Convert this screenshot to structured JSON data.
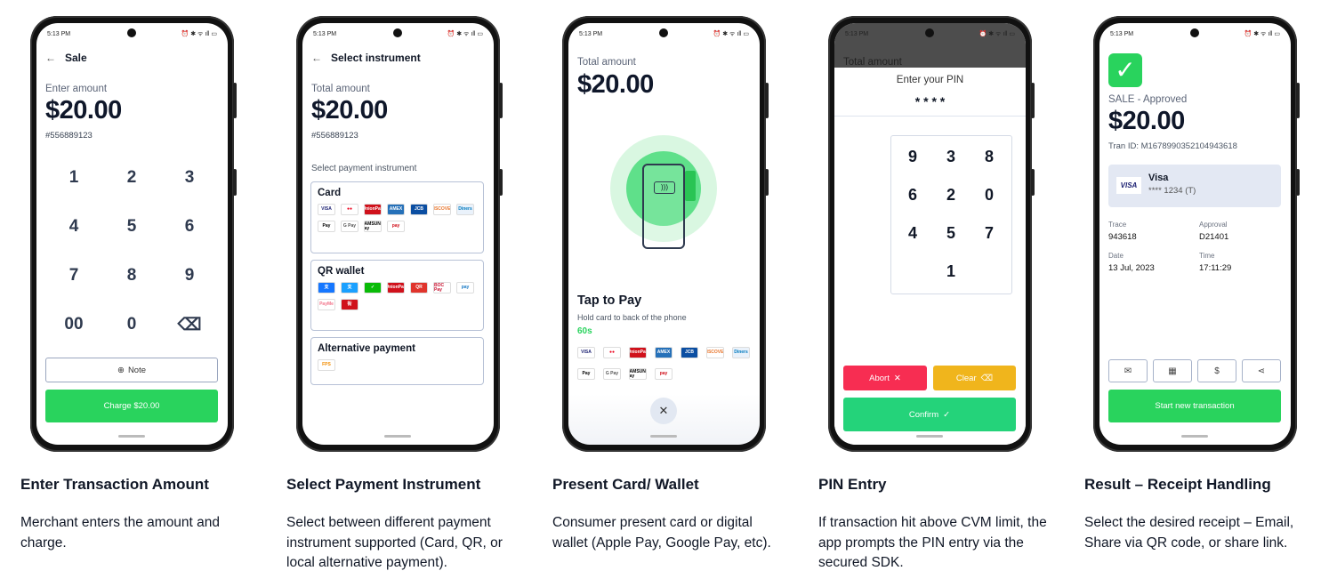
{
  "status": {
    "time": "5:13 PM",
    "icons": [
      "alarm-icon",
      "bluetooth-icon",
      "wifi-icon",
      "signal-icon",
      "battery-icon"
    ]
  },
  "colors": {
    "green": "#29d35d",
    "red": "#f72d52",
    "amber": "#f0b51c",
    "confirm": "#24d37a"
  },
  "screen1": {
    "title": "Sale",
    "label": "Enter amount",
    "amount": "$20.00",
    "ref": "#556889123",
    "keys": [
      "1",
      "2",
      "3",
      "4",
      "5",
      "6",
      "7",
      "8",
      "9",
      "00",
      "0",
      "⌫"
    ],
    "note": "Note",
    "charge": "Charge $20.00"
  },
  "screen2": {
    "title": "Select instrument",
    "label": "Total amount",
    "amount": "$20.00",
    "ref": "#556889123",
    "section": "Select payment instrument",
    "groups": [
      {
        "title": "Card",
        "logos": [
          [
            "VISA",
            "#fff",
            "#1a1f71"
          ],
          [
            "●●",
            "#fff",
            "#eb001b"
          ],
          [
            "UnionPay",
            "#d0111b",
            "#fff"
          ],
          [
            "AMEX",
            "#2671b9",
            "#fff"
          ],
          [
            "JCB",
            "#0b4ea2",
            "#fff"
          ],
          [
            "DISCOVER",
            "#fff",
            "#e8762d"
          ],
          [
            "Diners",
            "#eaf2fb",
            "#0079be"
          ],
          [
            "Pay",
            "#fff",
            "#000"
          ],
          [
            "G Pay",
            "#fff",
            "#555"
          ],
          [
            "SAMSUNG Pay",
            "#fff",
            "#000"
          ],
          [
            "pay",
            "#fff",
            "#d0111b"
          ]
        ]
      },
      {
        "title": "QR wallet",
        "logos": [
          [
            "支",
            "#1677ff",
            "#fff"
          ],
          [
            "支",
            "#1aa0ff",
            "#fff"
          ],
          [
            "✓",
            "#09bb07",
            "#fff"
          ],
          [
            "UnionPay",
            "#d0111b",
            "#fff"
          ],
          [
            "QR",
            "#e0342c",
            "#fff"
          ],
          [
            "BOC Pay",
            "#fff",
            "#c8102e"
          ],
          [
            "pay",
            "#fff",
            "#1a7bc6"
          ],
          [
            "PayMe",
            "#fff",
            "#f2748a"
          ],
          [
            "街",
            "#d0111b",
            "#fff"
          ]
        ]
      },
      {
        "title": "Alternative payment",
        "logos": [
          [
            "FPS",
            "#fff",
            "#f28c00"
          ]
        ]
      }
    ]
  },
  "screen3": {
    "label": "Total amount",
    "amount": "$20.00",
    "tap": "Tap to Pay",
    "hint": "Hold card to back of the phone",
    "timer": "60s",
    "logos": [
      [
        "VISA",
        "#fff",
        "#1a1f71"
      ],
      [
        "●●",
        "#fff",
        "#eb001b"
      ],
      [
        "UnionPay",
        "#d0111b",
        "#fff"
      ],
      [
        "AMEX",
        "#2671b9",
        "#fff"
      ],
      [
        "JCB",
        "#0b4ea2",
        "#fff"
      ],
      [
        "DISCOVER",
        "#fff",
        "#e8762d"
      ],
      [
        "Diners",
        "#eaf2fb",
        "#0079be"
      ],
      [
        "Pay",
        "#fff",
        "#000"
      ],
      [
        "G Pay",
        "#fff",
        "#555"
      ],
      [
        "SAMSUNG Pay",
        "#fff",
        "#000"
      ],
      [
        "pay",
        "#fff",
        "#d0111b"
      ]
    ]
  },
  "screen4": {
    "behind": "Total amount",
    "title": "Enter your PIN",
    "masked": "* * * *",
    "keys": [
      "9",
      "3",
      "8",
      "6",
      "2",
      "0",
      "4",
      "5",
      "7",
      "1"
    ],
    "abort": "Abort",
    "clear": "Clear",
    "confirm": "Confirm"
  },
  "screen5": {
    "status": "SALE - Approved",
    "amount": "$20.00",
    "tran": "Tran ID: M1678990352104943618",
    "card_brand": "VISA",
    "card_name": "Visa",
    "card_num": "**** 1234 (T)",
    "fields": [
      {
        "label": "Trace",
        "value": "943618"
      },
      {
        "label": "Approval",
        "value": "D21401"
      },
      {
        "label": "Date",
        "value": "13 Jul, 2023"
      },
      {
        "label": "Time",
        "value": "17:11:29"
      }
    ],
    "receipt_buttons": [
      "email-icon",
      "qr-code-icon",
      "receipt-icon",
      "share-icon"
    ],
    "start": "Start new transaction"
  },
  "captions": [
    {
      "title": "Enter Transaction Amount",
      "text": "Merchant enters the amount and charge."
    },
    {
      "title": "Select Payment Instrument",
      "text": "Select between different payment instrument supported (Card, QR, or local alternative payment)."
    },
    {
      "title": "Present Card/ Wallet",
      "text": "Consumer present card or digital wallet (Apple Pay, Google Pay, etc)."
    },
    {
      "title": "PIN Entry",
      "text": "If transaction hit above CVM limit, the app prompts the PIN entry via the secured SDK."
    },
    {
      "title": "Result – Receipt Handling",
      "text": "Select the desired receipt – Email, Share via QR code, or share link."
    }
  ]
}
